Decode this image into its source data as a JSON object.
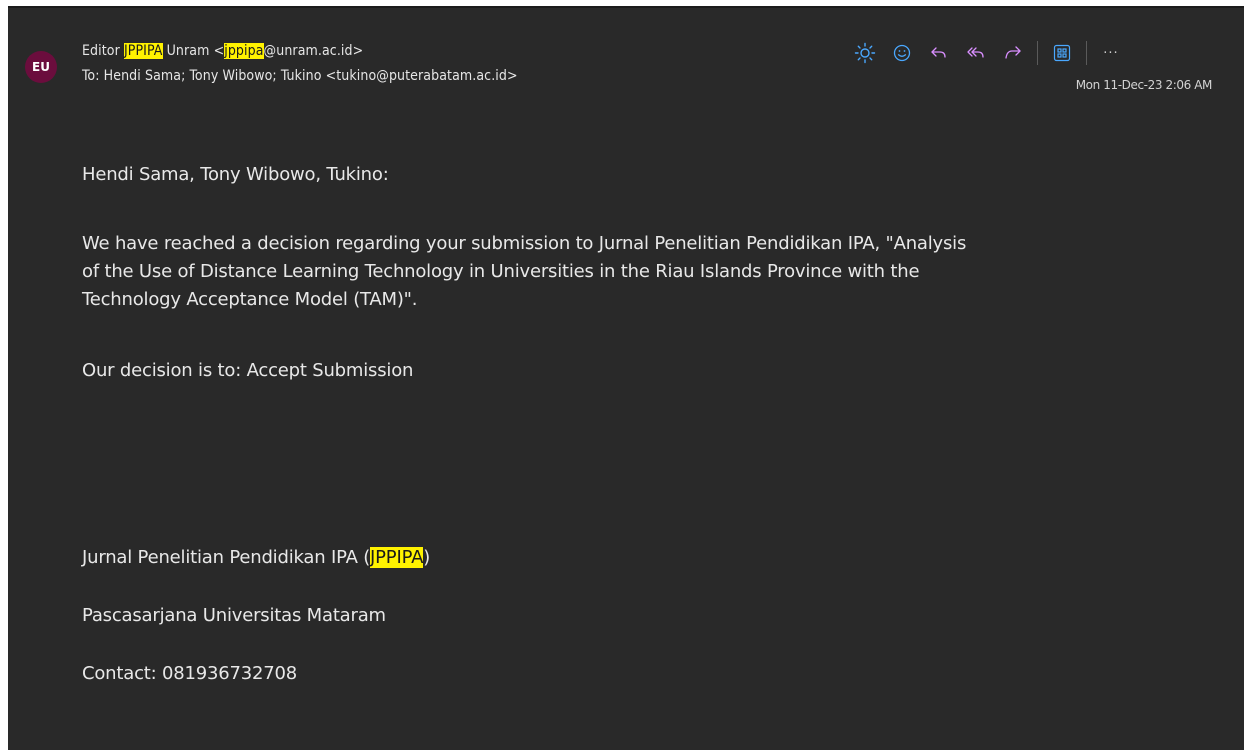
{
  "header": {
    "avatar_initials": "EU",
    "from_prefix": "Editor ",
    "from_hl1": "JPPIPA",
    "from_mid": " Unram <",
    "from_hl2": "jppipa",
    "from_suffix": "@unram.ac.id>",
    "to_text": "To: Hendi Sama;  Tony Wibowo;  Tukino <tukino@puterabatam.ac.id>",
    "date": "Mon 11-Dec-23 2:06 AM"
  },
  "toolbar": {
    "icons": [
      "brightness-icon",
      "emoji-icon",
      "reply-icon",
      "reply-all-icon",
      "forward-icon",
      "apps-icon",
      "more-icon"
    ],
    "more_label": "···",
    "accent_color": "#e45bff",
    "sun_color": "#4aa8ff"
  },
  "body": {
    "greeting": "Hendi Sama, Tony Wibowo, Tukino:",
    "para1_line1": "We have reached a decision regarding your submission to Jurnal Penelitian Pendidikan IPA, \"Analysis",
    "para1_line2": "of the Use of Distance Learning Technology in Universities in the Riau Islands Province with the",
    "para1_line3": "Technology Acceptance Model (TAM)\".",
    "decision": "Our decision is to: Accept Submission"
  },
  "signature": {
    "journal_prefix": "Jurnal Penelitian Pendidikan IPA (",
    "journal_hl": "JPPIPA",
    "journal_suffix": ")",
    "university": "Pascasarjana Universitas Mataram",
    "contact": "Contact: 081936732708"
  },
  "colors": {
    "background": "#292929",
    "highlight": "#fff200",
    "avatar": "#6b0d3d"
  }
}
